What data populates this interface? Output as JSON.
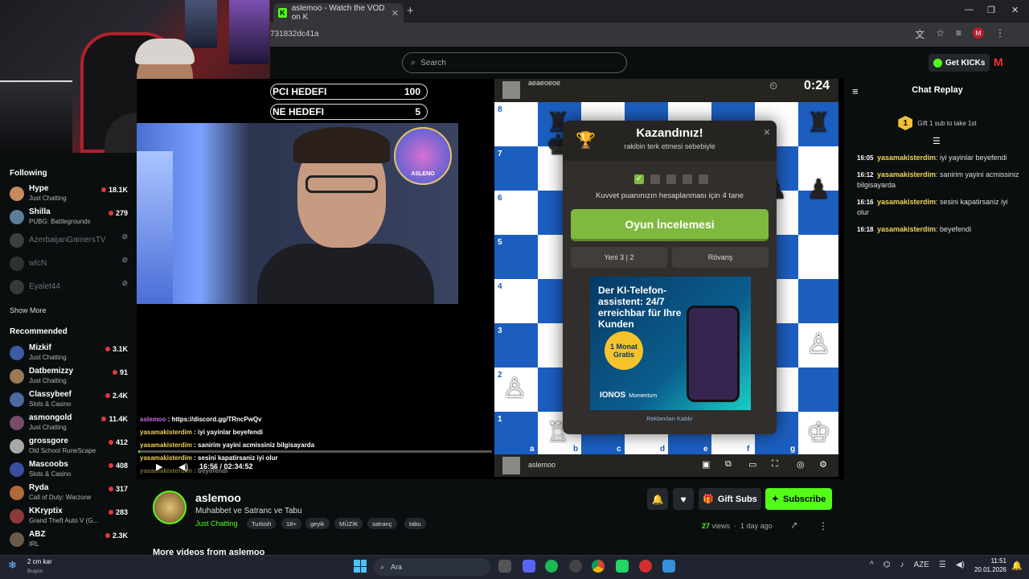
{
  "browser": {
    "tab_title": "aslemoo - Watch the VOD on K",
    "url_fragment": "731832dc41a",
    "new_tab": "+",
    "window_min": "—",
    "window_max": "❐",
    "window_close": "✕"
  },
  "header": {
    "search_placeholder": "Search",
    "get_kicks": "Get KICKs"
  },
  "sidebar": {
    "following_title": "Following",
    "following": [
      {
        "name": "Hype",
        "category": "Just Chatting",
        "viewers": "18.1K",
        "online": true
      },
      {
        "name": "Shilla",
        "category": "PUBG: Battlegrounds",
        "viewers": "279",
        "online": true
      },
      {
        "name": "AzerbaijanGamersTV",
        "category": "",
        "viewers": "",
        "online": false
      },
      {
        "name": "wtcN",
        "category": "",
        "viewers": "",
        "online": false
      },
      {
        "name": "Eyalet44",
        "category": "",
        "viewers": "",
        "online": false
      }
    ],
    "show_more": "Show More",
    "recommended_title": "Recommended",
    "recommended": [
      {
        "name": "Mizkif",
        "category": "Just Chatting",
        "viewers": "3.1K"
      },
      {
        "name": "Datbemizzy",
        "category": "Just Chatting",
        "viewers": "91"
      },
      {
        "name": "Classybeef",
        "category": "Slots & Casino",
        "viewers": "2.4K"
      },
      {
        "name": "asmongold",
        "category": "Just Chatting",
        "viewers": "11.4K"
      },
      {
        "name": "grossgore",
        "category": "Old School RuneScape",
        "viewers": "412"
      },
      {
        "name": "Mascoobs",
        "category": "Slots & Casino",
        "viewers": "408"
      },
      {
        "name": "Ryda",
        "category": "Call of Duty: Warzone",
        "viewers": "317"
      },
      {
        "name": "KKryptix",
        "category": "Grand Theft Auto V (G...",
        "viewers": "283"
      },
      {
        "name": "ABZ",
        "category": "IRL",
        "viewers": "2.3K"
      }
    ]
  },
  "stream": {
    "goal1_label": "PCI HEDEFI",
    "goal1_value": "100",
    "goal2_label": "NE HEDEFI",
    "goal2_value": "5",
    "logo_text": "ASLENO",
    "overlay_chat": [
      {
        "user": "aslemoo",
        "text": ": https://discord.gg/TRncPwQv"
      },
      {
        "user": "yasamakisterdim",
        "text": ": iyi yayinlar beyefendi"
      },
      {
        "user": "yasamakisterdim",
        "text": ": sanirim yayini acmissiniz bilgisayarda"
      },
      {
        "user": "yasamakisterdim",
        "text": ": sesini kapatirsaniz iyi olur"
      },
      {
        "user": "yasamakisterdim",
        "text": ": beyefendi"
      }
    ],
    "time": "16:56 / 02:34:52",
    "progress": 0.005
  },
  "chess": {
    "opponent": "aeaeoeoe",
    "player": "aslemoo",
    "clock": "0:24",
    "ranks": [
      "8",
      "7",
      "6",
      "5",
      "4",
      "3",
      "2",
      "1"
    ],
    "files": [
      "a",
      "b",
      "c",
      "d",
      "e",
      "f",
      "g"
    ],
    "modal": {
      "title": "Kazandınız!",
      "subtitle": "rakibin terk etmesi sebebiyle",
      "rating_note": "Kuvvet puanınızın hesaplanması için 4 tane",
      "review": "Oyun İncelemesi",
      "new_game": "Yeni 3 | 2",
      "rematch": "Rövanş",
      "ad_text": "Der KI-Telefon-assistent: 24/7 erreichbar für Ihre Kunden",
      "ad_badge": "1 Monat Gratis",
      "ad_brand": "IONOS",
      "ad_brand_sub": "Momentum",
      "remove_ads": "Reklamları Kaldır",
      "close": "×"
    }
  },
  "chat": {
    "title": "Chat Replay",
    "gift_rank": "1",
    "gift_text": "Gift 1 sub to take 1st",
    "messages": [
      {
        "time": "16:05",
        "user": "yasamakisterdim",
        "text": ": iyi yayinlar beyefendi"
      },
      {
        "time": "16:12",
        "user": "yasamakisterdim",
        "text": ": sanirim yayini acmissiniz bilgisayarda"
      },
      {
        "time": "16:16",
        "user": "yasamakisterdim",
        "text": ": sesini kapatirsaniz iyi olur"
      },
      {
        "time": "16:18",
        "user": "yasamakisterdim",
        "text": ": beyefendi"
      }
    ]
  },
  "channel": {
    "name": "aslemoo",
    "title": "Muhabbet ve Satranc ve Tabu",
    "category": "Just Chatting",
    "tags": [
      "Turkish",
      "18+",
      "geyik",
      "MÜZİK",
      "satranç",
      "tabu"
    ],
    "gift_subs": "Gift Subs",
    "subscribe": "Subscribe",
    "views_count": "27",
    "views_label": "views",
    "ago": "1 day ago",
    "more_videos": "More videos from aslemoo"
  },
  "taskbar": {
    "weather_temp": "2 cm kar",
    "weather_day": "Bugün",
    "search": "Ara",
    "lang": "AZE",
    "time": "11:51",
    "date": "20.01.2026"
  },
  "colors": {
    "kick_green": "#53fc18",
    "board_dark": "#1c5ec0",
    "board_light": "#ffffff",
    "username_yellow": "#f2d35c"
  }
}
